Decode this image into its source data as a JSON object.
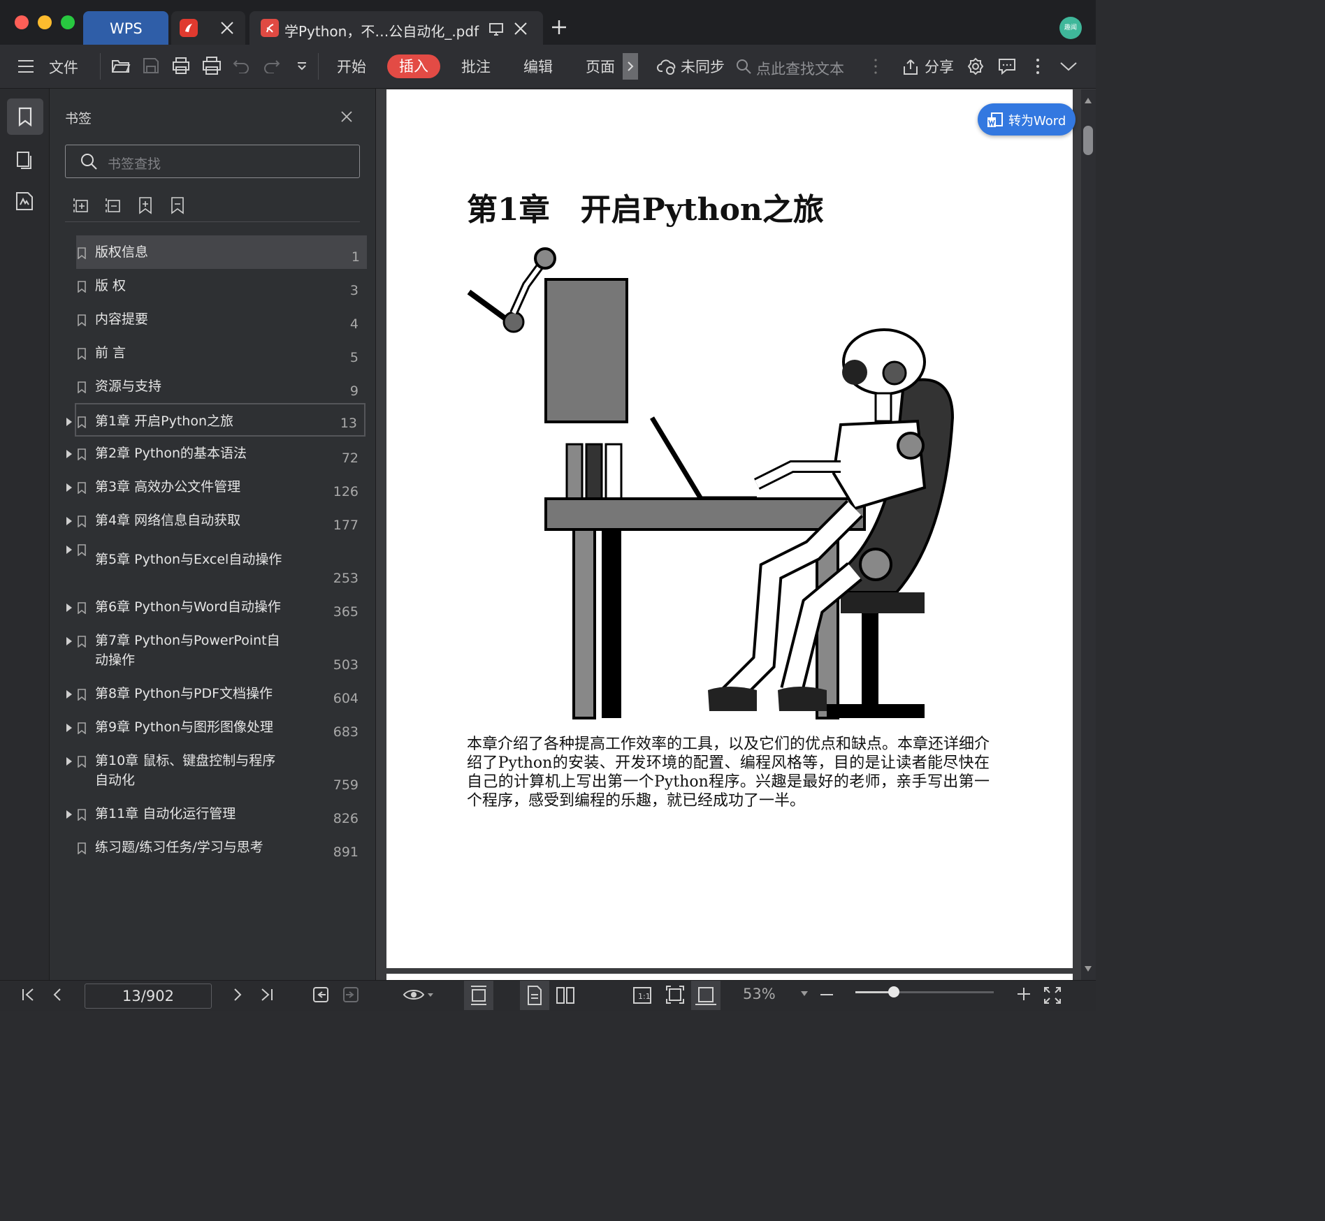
{
  "window": {
    "tabs": [
      {
        "label": "WPS"
      },
      {
        "label": "学Python，不…公自动化_.pdf"
      }
    ],
    "avatar_text": "趣闻"
  },
  "toolbar": {
    "file_label": "文件",
    "menu_tabs": [
      "开始",
      "插入",
      "批注",
      "编辑",
      "页面"
    ],
    "active_tab": "插入",
    "sync_label": "未同步",
    "search_placeholder": "点此查找文本",
    "share_label": "分享"
  },
  "bookmarks": {
    "title": "书签",
    "search_placeholder": "书签查找",
    "items": [
      {
        "label": "版权信息",
        "page": "1"
      },
      {
        "label": "版 权",
        "page": "3"
      },
      {
        "label": "内容提要",
        "page": "4"
      },
      {
        "label": "前 言",
        "page": "5"
      },
      {
        "label": "资源与支持",
        "page": "9"
      },
      {
        "label": "第1章 开启Python之旅",
        "page": "13"
      },
      {
        "label": "第2章 Python的基本语法",
        "page": "72"
      },
      {
        "label": "第3章 高效办公文件管理",
        "page": "126"
      },
      {
        "label": "第4章 网络信息自动获取",
        "page": "177"
      },
      {
        "label": "第5章 Python与Excel自动操作",
        "page": "253"
      },
      {
        "label": "第6章 Python与Word自动操作",
        "page": "365"
      },
      {
        "label": "第7章 Python与PowerPoint自\n动操作",
        "page": "503"
      },
      {
        "label": "第8章 Python与PDF文档操作",
        "page": "604"
      },
      {
        "label": "第9章 Python与图形图像处理",
        "page": "683"
      },
      {
        "label": "第10章 鼠标、键盘控制与程序\n自动化",
        "page": "759"
      },
      {
        "label": "第11章 自动化运行管理",
        "page": "826"
      },
      {
        "label": "练习题/练习任务/学习与思考",
        "page": "891"
      }
    ]
  },
  "document": {
    "convert_button": "转为Word",
    "chapter_title": "第1章　开启Python之旅",
    "paragraph": "本章介绍了各种提高工作效率的工具，以及它们的优点和缺点。本章还详细介绍了Python的安装、开发环境的配置、编程风格等，目的是让读者能尽快在自己的计算机上写出第一个Python程序。兴趣是最好的老师，亲手写出第一个程序，感受到编程的乐趣，就已经成功了一半。"
  },
  "statusbar": {
    "page_indicator": "13/902",
    "zoom": "53%",
    "zoom_fraction": 0.28
  }
}
